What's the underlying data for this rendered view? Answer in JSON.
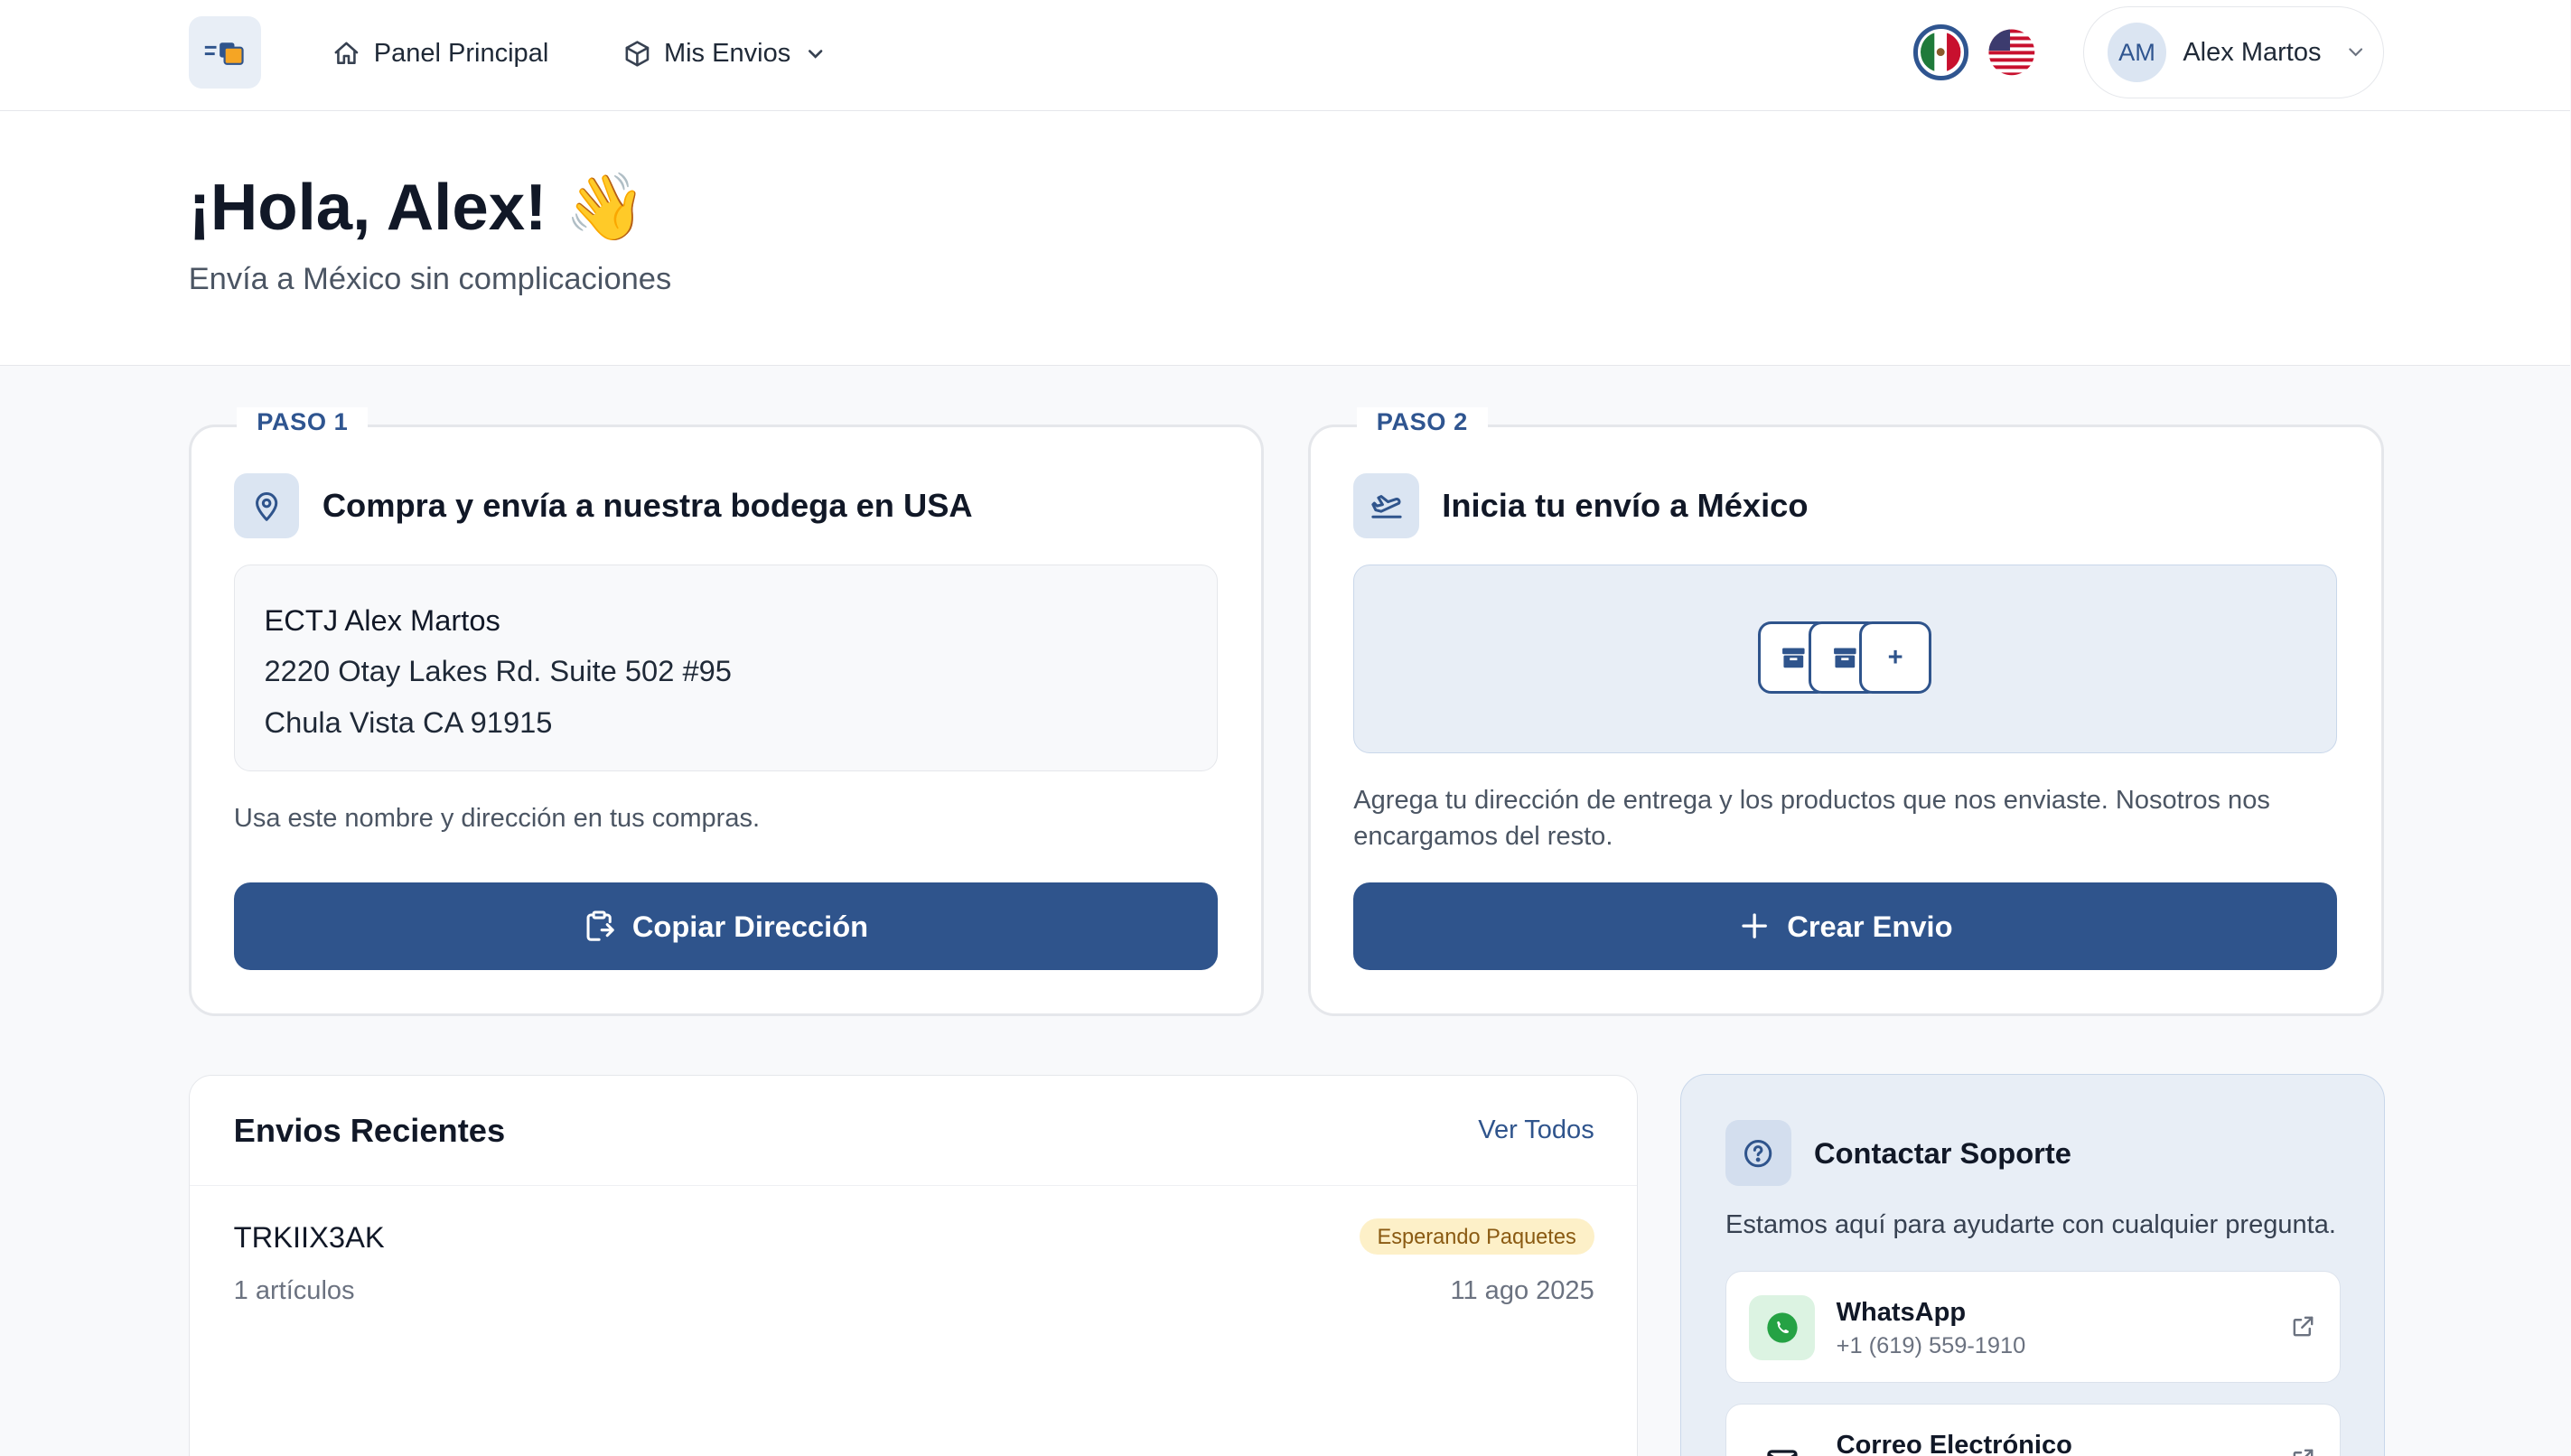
{
  "header": {
    "logo_icon": "boxes-logo-icon",
    "nav": [
      {
        "label": "Panel Principal",
        "icon": "home-icon"
      },
      {
        "label": "Mis Envios",
        "icon": "package-icon"
      }
    ],
    "languages": [
      "mexico-flag",
      "usa-flag"
    ],
    "user": {
      "initials": "AM",
      "name": "Alex Martos"
    }
  },
  "greeting": {
    "title": "¡Hola, Alex! 👋",
    "subtitle": "Envía a México sin complicaciones"
  },
  "step1": {
    "label": "PASO 1",
    "title": "Compra y envía a nuestra bodega en USA",
    "address_lines": [
      "ECTJ Alex Martos",
      "2220 Otay Lakes Rd. Suite 502 #95",
      "Chula Vista CA 91915"
    ],
    "note": "Usa este nombre y dirección en tus compras.",
    "button": "Copiar Dirección"
  },
  "step2": {
    "label": "PASO 2",
    "title": "Inicia tu envío a México",
    "add_symbol": "+",
    "note": "Agrega tu dirección de entrega y los productos que nos enviaste. Nosotros nos encargamos del resto.",
    "button": "Crear Envio"
  },
  "recent": {
    "title": "Envios Recientes",
    "see_all": "Ver Todos",
    "items": [
      {
        "id": "TRKIIX3AK",
        "count": "1 artículos",
        "status": "Esperando Paquetes",
        "date": "11 ago 2025"
      }
    ]
  },
  "support": {
    "title": "Contactar Soporte",
    "subtitle": "Estamos aquí para ayudarte con cualquier pregunta.",
    "contacts": [
      {
        "name": "WhatsApp",
        "value": "+1 (619) 559-1910"
      },
      {
        "name": "Correo Electrónico",
        "value": ""
      }
    ]
  },
  "colors": {
    "primary": "#2f548c",
    "badge_bg": "#fdf0c8",
    "badge_text": "#8a5a12",
    "whatsapp": "#25a244"
  }
}
